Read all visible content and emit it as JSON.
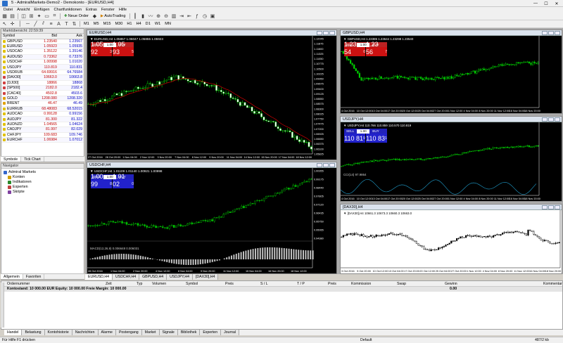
{
  "window": {
    "title": "5 - AdmiralMarkets-Demo2 - Demokonto - [EURUSD,H4]",
    "minimize": "—",
    "maximize": "☐",
    "close": "✕"
  },
  "menu": [
    "Datei",
    "Ansicht",
    "Einfügen",
    "Chartfunktionen",
    "Extras",
    "Fenster",
    "Hilfe"
  ],
  "toolbar": {
    "new_order": "Neue Order",
    "auto_trading": "AutoTrading",
    "timeframes": [
      "M1",
      "M5",
      "M15",
      "M30",
      "H1",
      "H4",
      "D1",
      "W1",
      "MN"
    ]
  },
  "market_watch": {
    "header": "Marktübersicht: 22:59:39",
    "columns": [
      "Symbol",
      "Bid",
      "Ask"
    ],
    "rows": [
      {
        "symbol": "GBPUSD",
        "bid": "1.23540",
        "ask": "1.23567",
        "color": "#e0c000"
      },
      {
        "symbol": "EURUSD",
        "bid": "1.05923",
        "ask": "1.05935",
        "color": "#e0c000"
      },
      {
        "symbol": "USDCAD",
        "bid": "1.35122",
        "ask": "1.35146",
        "color": "#e0c000"
      },
      {
        "symbol": "AUDUSD",
        "bid": "0.73362",
        "ask": "0.73376",
        "color": "#e0c000"
      },
      {
        "symbol": "USDCHF",
        "bid": "1.00998",
        "ask": "1.01020",
        "color": "#e0c000"
      },
      {
        "symbol": "USDJPY",
        "bid": "110.819",
        "ask": "110.831",
        "color": "#e0c000"
      },
      {
        "symbol": "USDRUB",
        "bid": "64.69916",
        "ask": "64.76584",
        "color": "#e0c000"
      },
      {
        "symbol": "[DAX30]",
        "bid": "10663.0",
        "ask": "10663.8",
        "color": "#d04040"
      },
      {
        "symbol": "[DJI30]",
        "bid": "18866",
        "ask": "18868",
        "color": "#d04040"
      },
      {
        "symbol": "[SP500]",
        "bid": "2182.0",
        "ask": "2182.4",
        "color": "#d04040"
      },
      {
        "symbol": "[CAC40]",
        "bid": "4502.8",
        "ask": "4503.6",
        "color": "#d04040"
      },
      {
        "symbol": "GOLD",
        "bid": "1208.080",
        "ask": "1208.320",
        "color": "#e0a000"
      },
      {
        "symbol": "BRENT",
        "bid": "46.47",
        "ask": "46.49",
        "color": "#e0a000"
      },
      {
        "symbol": "EURRUB",
        "bid": "68.48083",
        "ask": "68.52015",
        "color": "#e0c000"
      },
      {
        "symbol": "AUDCAD",
        "bid": "0.99128",
        "ask": "0.99156",
        "color": "#e0c000"
      },
      {
        "symbol": "AUDJPY",
        "bid": "81.300",
        "ask": "81.322",
        "color": "#e0c000"
      },
      {
        "symbol": "AUDNZD",
        "bid": "1.04565",
        "ask": "1.04624",
        "color": "#e0c000"
      },
      {
        "symbol": "CADJPY",
        "bid": "81.997",
        "ask": "82.029",
        "color": "#e0c000"
      },
      {
        "symbol": "CHFJPY",
        "bid": "109.683",
        "ask": "109.746",
        "color": "#e0c000"
      },
      {
        "symbol": "EURCHF",
        "bid": "1.06984",
        "ask": "1.07012",
        "color": "#e0c000"
      }
    ],
    "tabs": [
      "Symbole",
      "Tick Chart"
    ]
  },
  "navigator": {
    "header": "Navigator",
    "items": [
      "Admiral Markets",
      "Konten",
      "Indikatoren",
      "Experten",
      "Skripte"
    ],
    "tabs": [
      "Allgemein",
      "Favoriten"
    ]
  },
  "charts": {
    "eurusd": {
      "title": "EURUSD,H4",
      "info": "▼ EURUSD,H4  1.05857 1.06047 1.05855 1.05923",
      "sell": "SELL",
      "buy": "BUY",
      "lot": "1.00",
      "sell_big": "1.05 92",
      "sell_sup": "3",
      "buy_big": "1.05 93",
      "buy_sup": "5",
      "prices": [
        "1.12045",
        "1.11875",
        "1.11600",
        "1.11325",
        "1.11050",
        "1.10775",
        "1.10500",
        "1.10225",
        "1.09950",
        "1.09675",
        "1.09400",
        "1.09125",
        "1.08850",
        "1.08575",
        "1.08300",
        "1.08025",
        "1.07750",
        "1.07475",
        "1.07200",
        "1.06925",
        "1.06650",
        "1.06375",
        "1.06100",
        "1.05825"
      ],
      "times": [
        "27 Oct 2016",
        "28 Oct 20:00",
        "1 Nov 04:00",
        "2 Nov 12:00",
        "3 Nov 20:00",
        "7 Nov 04:00",
        "8 Nov 12:00",
        "9 Nov 20:00",
        "11 Nov 04:00",
        "14 Nov 12:00",
        "15 Nov 20:00",
        "17 Nov 04:00",
        "18 Nov 12:00"
      ]
    },
    "gbpusd": {
      "title": "GBPUSD,H4",
      "info": "▼ GBPUSD,H4  1.23385 1.23644 1.23298 1.23540",
      "sell_big": "1.23 54",
      "sell_sup": "0",
      "buy_big": "1.23 56",
      "buy_sup": "7",
      "times": [
        "4 Oct 2016",
        "10 Oct 12:00",
        "13 Oct 04:00",
        "17 Oct 20:00",
        "20 Oct 12:00",
        "25 Oct 04:00",
        "27 Oct 20:00",
        "1 Nov 12:00",
        "4 Nov 04:00",
        "8 Nov 20:00",
        "11 Nov 12:00",
        "16 Nov 04:00",
        "18 Nov 20:00"
      ]
    },
    "usdjpy": {
      "title": "USDJPY,H4",
      "info": "▼ USDJPY,H4  110.766 110.859 110.570 110.819",
      "sell_big": "110 81",
      "sell_sup": "9",
      "buy_big": "110 83",
      "buy_sup": "1",
      "cci": "CCI(14) 97.9864",
      "times": [
        "4 Oct 2016",
        "10 Oct 12:00",
        "13 Oct 04:00",
        "17 Oct 20:00",
        "20 Oct 12:00",
        "25 Oct 04:00",
        "27 Oct 20:00",
        "1 Nov 12:00",
        "4 Nov 04:00",
        "8 Nov 20:00",
        "11 Nov 12:00",
        "16 Nov 04:00",
        "18 Nov 20:00"
      ]
    },
    "usdchf": {
      "title": "USDCHF,H4",
      "info": "▼ USDCHF,H4  1.01109 1.01140 1.00921 1.00998",
      "sell_big": "1.00 99",
      "sell_sup": "8",
      "buy_big": "1.01 02",
      "buy_sup": "0",
      "macd": "MACD(12,26,9) 0.006648 0.006031",
      "prices": [
        "1.00355",
        "0.99175",
        "0.98440",
        "0.97805",
        "0.97120",
        "0.96435",
        "0.95750",
        "0.95065",
        "0.94380"
      ],
      "times": [
        "28 Oct 2016",
        "1 Nov 04:00",
        "2 Nov 20:00",
        "4 Nov 12:00",
        "8 Nov 04:00",
        "9 Nov 20:00",
        "11 Nov 12:00",
        "15 Nov 04:00",
        "16 Nov 20:00",
        "18 Nov 12:00"
      ]
    },
    "dax": {
      "title": "[DAX30],H4",
      "info": "▼ [DAX30],H4  10661.3 10673.3 10660.3 10663.0",
      "times": [
        "3 Oct 2016",
        "5 Oct 20:00",
        "10 Oct 12:00",
        "13 Oct 04:00",
        "17 Oct 20:00",
        "20 Oct 12:00",
        "25 Oct 04:00",
        "27 Oct 20:00",
        "1 Nov 12:00",
        "4 Nov 04:00",
        "8 Nov 20:00",
        "11 Nov 12:00",
        "16 Nov 04:00",
        "18 Nov 20:00"
      ]
    }
  },
  "chart_tabs": [
    "EURUSD,H4",
    "USDCHF,H4",
    "GBPUSD,H4",
    "USDJPY,H4",
    "[DAX30],H4"
  ],
  "terminal": {
    "columns": [
      "Ordernummer",
      "Zeit",
      "Typ",
      "Volumen",
      "Symbol",
      "Preis",
      "S / L",
      "T / P",
      "Preis",
      "Kommission",
      "Swap",
      "Gewinn",
      "Kommentar"
    ],
    "balance": "Kontostand: 10 000.00 EUR  Equity: 10 000.00  Freie Margin: 10 000.00",
    "profit": "0.00",
    "tabs": [
      "Handel",
      "Belastung",
      "Kontohistorie",
      "Nachrichten",
      "Alarme",
      "Postengang",
      "Market",
      "Signale",
      "Bibliothek",
      "Experten",
      "Journal"
    ]
  },
  "status": {
    "help": "Für Hilfe F1 drücken",
    "profile": "Default",
    "traffic": "487/2 kb"
  }
}
